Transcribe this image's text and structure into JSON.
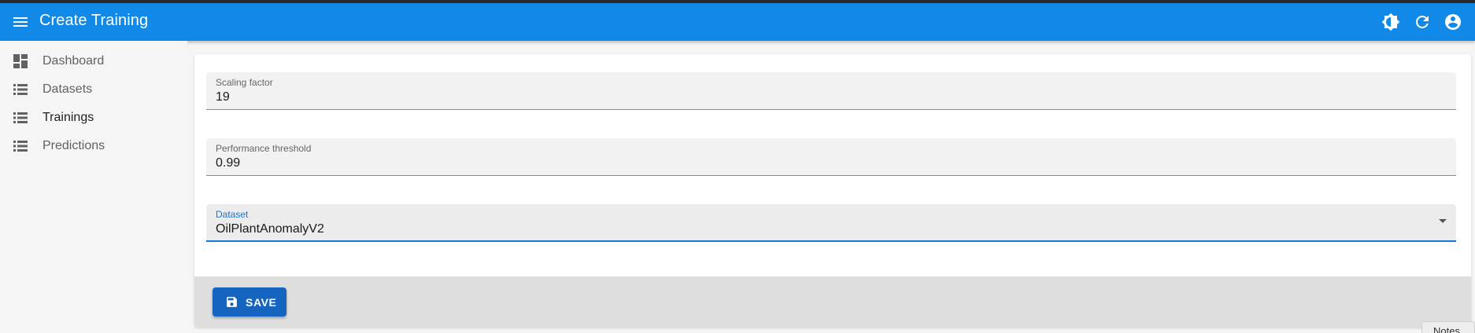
{
  "app": {
    "title": "Create Training",
    "accent_color": "#1089e9",
    "icons": {
      "menu": "menu-icon",
      "theme": "brightness-icon",
      "refresh": "refresh-icon",
      "account": "account-circle-icon"
    }
  },
  "sidebar": {
    "items": [
      {
        "label": "Dashboard",
        "icon": "dashboard-icon"
      },
      {
        "label": "Datasets",
        "icon": "list-icon"
      },
      {
        "label": "Trainings",
        "icon": "list-icon"
      },
      {
        "label": "Predictions",
        "icon": "list-icon"
      }
    ]
  },
  "form": {
    "scaling_factor": {
      "label": "Scaling factor",
      "value": "19"
    },
    "performance_threshold": {
      "label": "Performance threshold",
      "value": "0.99"
    },
    "dataset": {
      "label": "Dataset",
      "value": "OilPlantAnomalyV2"
    }
  },
  "toolbar": {
    "save_label": "SAVE",
    "save_color": "#1565c0",
    "save_icon": "save-icon"
  },
  "notes": {
    "label": "Notes"
  }
}
